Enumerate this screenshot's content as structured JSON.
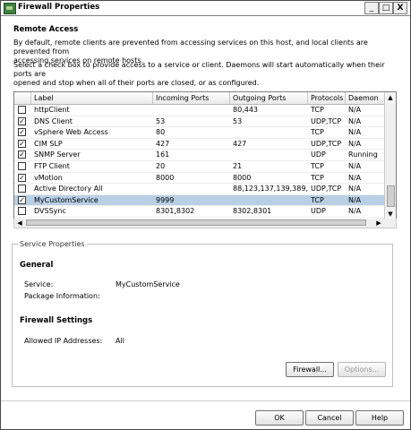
{
  "window": {
    "title": "Firewall Properties"
  },
  "title_buttons": {
    "minimize": "_",
    "maximize": "□",
    "close": "X"
  },
  "remote_access": {
    "heading": "Remote Access",
    "desc1_line1": "By default, remote clients are prevented from accessing services on this host, and local clients are prevented from",
    "desc1_line2": "accessing services on remote hosts.",
    "desc2_line1": "Select a check box to provide access to a service or client. Daemons will start automatically when their ports are",
    "desc2_line2": "opened and stop when all of their ports are closed, or as configured."
  },
  "grid": {
    "columns": [
      "Label",
      "Incoming Ports",
      "Outgoing Ports",
      "Protocols",
      "Daemon"
    ],
    "rows": [
      {
        "checked": false,
        "label": "httpClient",
        "incoming": "",
        "outgoing": "80,443",
        "protocols": "TCP",
        "daemon": "N/A"
      },
      {
        "checked": true,
        "label": "DNS Client",
        "incoming": "53",
        "outgoing": "53",
        "protocols": "UDP,TCP",
        "daemon": "N/A"
      },
      {
        "checked": true,
        "label": "vSphere Web Access",
        "incoming": "80",
        "outgoing": "",
        "protocols": "TCP",
        "daemon": "N/A"
      },
      {
        "checked": true,
        "label": "CIM SLP",
        "incoming": "427",
        "outgoing": "427",
        "protocols": "UDP,TCP",
        "daemon": "N/A"
      },
      {
        "checked": true,
        "label": "SNMP Server",
        "incoming": "161",
        "outgoing": "",
        "protocols": "UDP",
        "daemon": "Running"
      },
      {
        "checked": false,
        "label": "FTP Client",
        "incoming": "20",
        "outgoing": "21",
        "protocols": "TCP",
        "daemon": "N/A"
      },
      {
        "checked": true,
        "label": "vMotion",
        "incoming": "8000",
        "outgoing": "8000",
        "protocols": "TCP",
        "daemon": "N/A"
      },
      {
        "checked": false,
        "label": "Active Directory All",
        "incoming": "",
        "outgoing": "88,123,137,139,389,...",
        "protocols": "UDP,TCP",
        "daemon": "N/A"
      },
      {
        "checked": true,
        "label": "MyCustomService",
        "incoming": "9999",
        "outgoing": "",
        "protocols": "TCP",
        "daemon": "N/A",
        "selected": true
      },
      {
        "checked": false,
        "label": "DVSSync",
        "incoming": "8301,8302",
        "outgoing": "8302,8301",
        "protocols": "UDP",
        "daemon": "N/A"
      }
    ]
  },
  "service_properties": {
    "legend": "Service Properties",
    "general_heading": "General",
    "service_label": "Service:",
    "service_value": "MyCustomService",
    "package_label": "Package Information:",
    "package_value": "",
    "firewall_heading": "Firewall Settings",
    "allowed_ip_label": "Allowed IP Addresses:",
    "allowed_ip_value": "All",
    "firewall_button": "Firewall...",
    "options_button": "Options..."
  },
  "footer": {
    "ok": "OK",
    "cancel": "Cancel",
    "help": "Help"
  },
  "colors": {
    "selected_row": "#b8cfe6",
    "window_border": "#4a4a4a"
  }
}
